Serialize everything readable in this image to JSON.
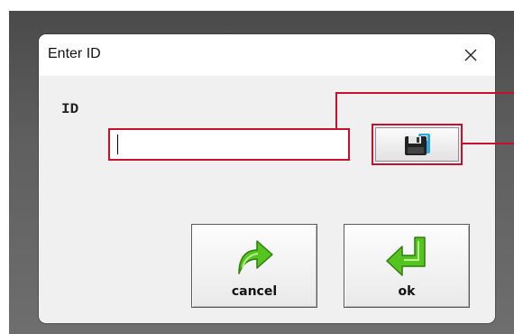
{
  "dialog": {
    "title": "Enter ID",
    "close_icon": "close-icon"
  },
  "form": {
    "id_label": "ID",
    "id_value": "",
    "save_icon": "floppy-disk-icon"
  },
  "buttons": {
    "cancel_label": "cancel",
    "cancel_icon": "redo-arrow-icon",
    "ok_label": "ok",
    "ok_icon": "enter-arrow-icon"
  },
  "colors": {
    "highlight": "#c8102e",
    "arrow_green": "#4fc01f"
  }
}
